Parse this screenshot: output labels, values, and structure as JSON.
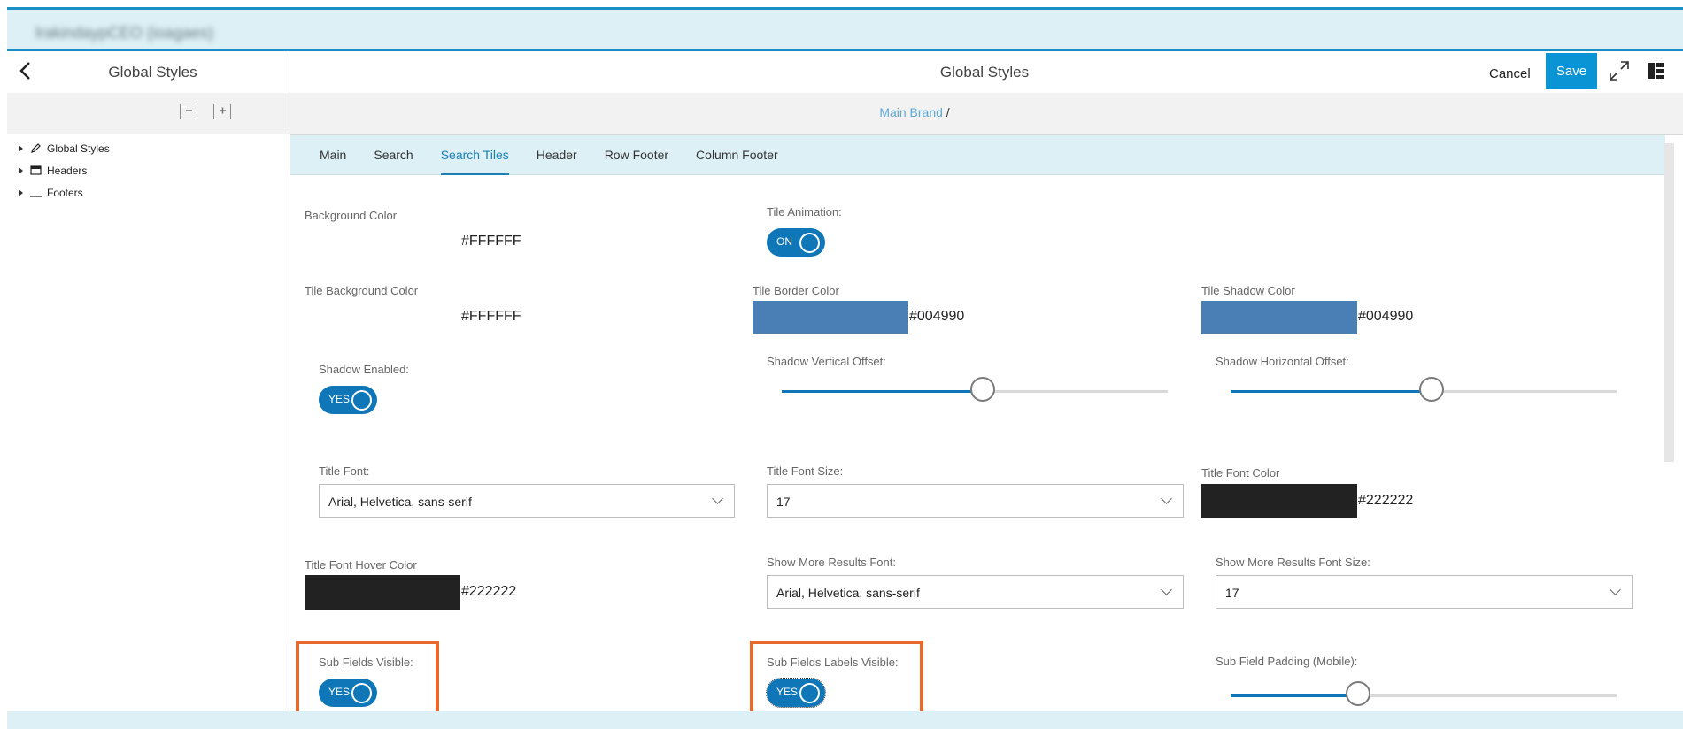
{
  "app": {
    "title": "lrakindaypCEO (ioagaes)"
  },
  "left_panel": {
    "title": "Global Styles",
    "back_icon": "chevron-left-icon",
    "tools": [
      {
        "icon": "collapse-all-icon"
      },
      {
        "icon": "expand-all-icon"
      }
    ],
    "tree": [
      {
        "label": "Global Styles",
        "icon": "pencil-icon"
      },
      {
        "label": "Headers",
        "icon": "window-icon"
      },
      {
        "label": "Footers",
        "icon": "underline-icon"
      }
    ]
  },
  "header": {
    "title": "Global Styles",
    "cancel": "Cancel",
    "save": "Save"
  },
  "breadcrumb": {
    "link": "Main Brand",
    "sep": " /"
  },
  "tabs": [
    {
      "label": "Main"
    },
    {
      "label": "Search"
    },
    {
      "label": "Search Tiles",
      "active": true
    },
    {
      "label": "Header"
    },
    {
      "label": "Row Footer"
    },
    {
      "label": "Column Footer"
    }
  ],
  "form": {
    "background_color": {
      "label": "Background Color",
      "value": "#FFFFFF"
    },
    "tile_animation": {
      "label": "Tile Animation:",
      "state": "ON"
    },
    "tile_background_color": {
      "label": "Tile Background Color",
      "value": "#FFFFFF"
    },
    "tile_border_color": {
      "label": "Tile Border Color",
      "value": "#004990",
      "swatch": "#4a7fb5"
    },
    "tile_shadow_color": {
      "label": "Tile Shadow Color",
      "value": "#004990",
      "swatch": "#4a7fb5"
    },
    "shadow_enabled": {
      "label": "Shadow Enabled:",
      "state": "YES"
    },
    "shadow_vertical_offset": {
      "label": "Shadow Vertical Offset:",
      "fraction": 0.52
    },
    "shadow_horizontal_offset": {
      "label": "Shadow Horizontal Offset:",
      "fraction": 0.52
    },
    "title_font": {
      "label": "Title Font:",
      "value": "Arial, Helvetica, sans-serif"
    },
    "title_font_size": {
      "label": "Title Font Size:",
      "value": "17"
    },
    "title_font_color": {
      "label": "Title Font Color",
      "value": "#222222",
      "swatch": "#222222"
    },
    "title_font_hover_color": {
      "label": "Title Font Hover Color",
      "value": "#222222",
      "swatch": "#222222"
    },
    "show_more_results_font": {
      "label": "Show More Results Font:",
      "value": "Arial, Helvetica, sans-serif"
    },
    "show_more_results_font_size": {
      "label": "Show More Results Font Size:",
      "value": "17"
    },
    "sub_fields_visible": {
      "label": "Sub Fields Visible:",
      "state": "YES"
    },
    "sub_fields_labels_visible": {
      "label": "Sub Fields Labels Visible:",
      "state": "YES"
    },
    "sub_field_padding_mobile": {
      "label": "Sub Field Padding (Mobile):",
      "fraction": 0.33
    }
  },
  "colors": {
    "accent": "#0f77b8",
    "save": "#0a94d6",
    "highlight": "#e8692c",
    "tab_bar": "#dcf0f5"
  }
}
